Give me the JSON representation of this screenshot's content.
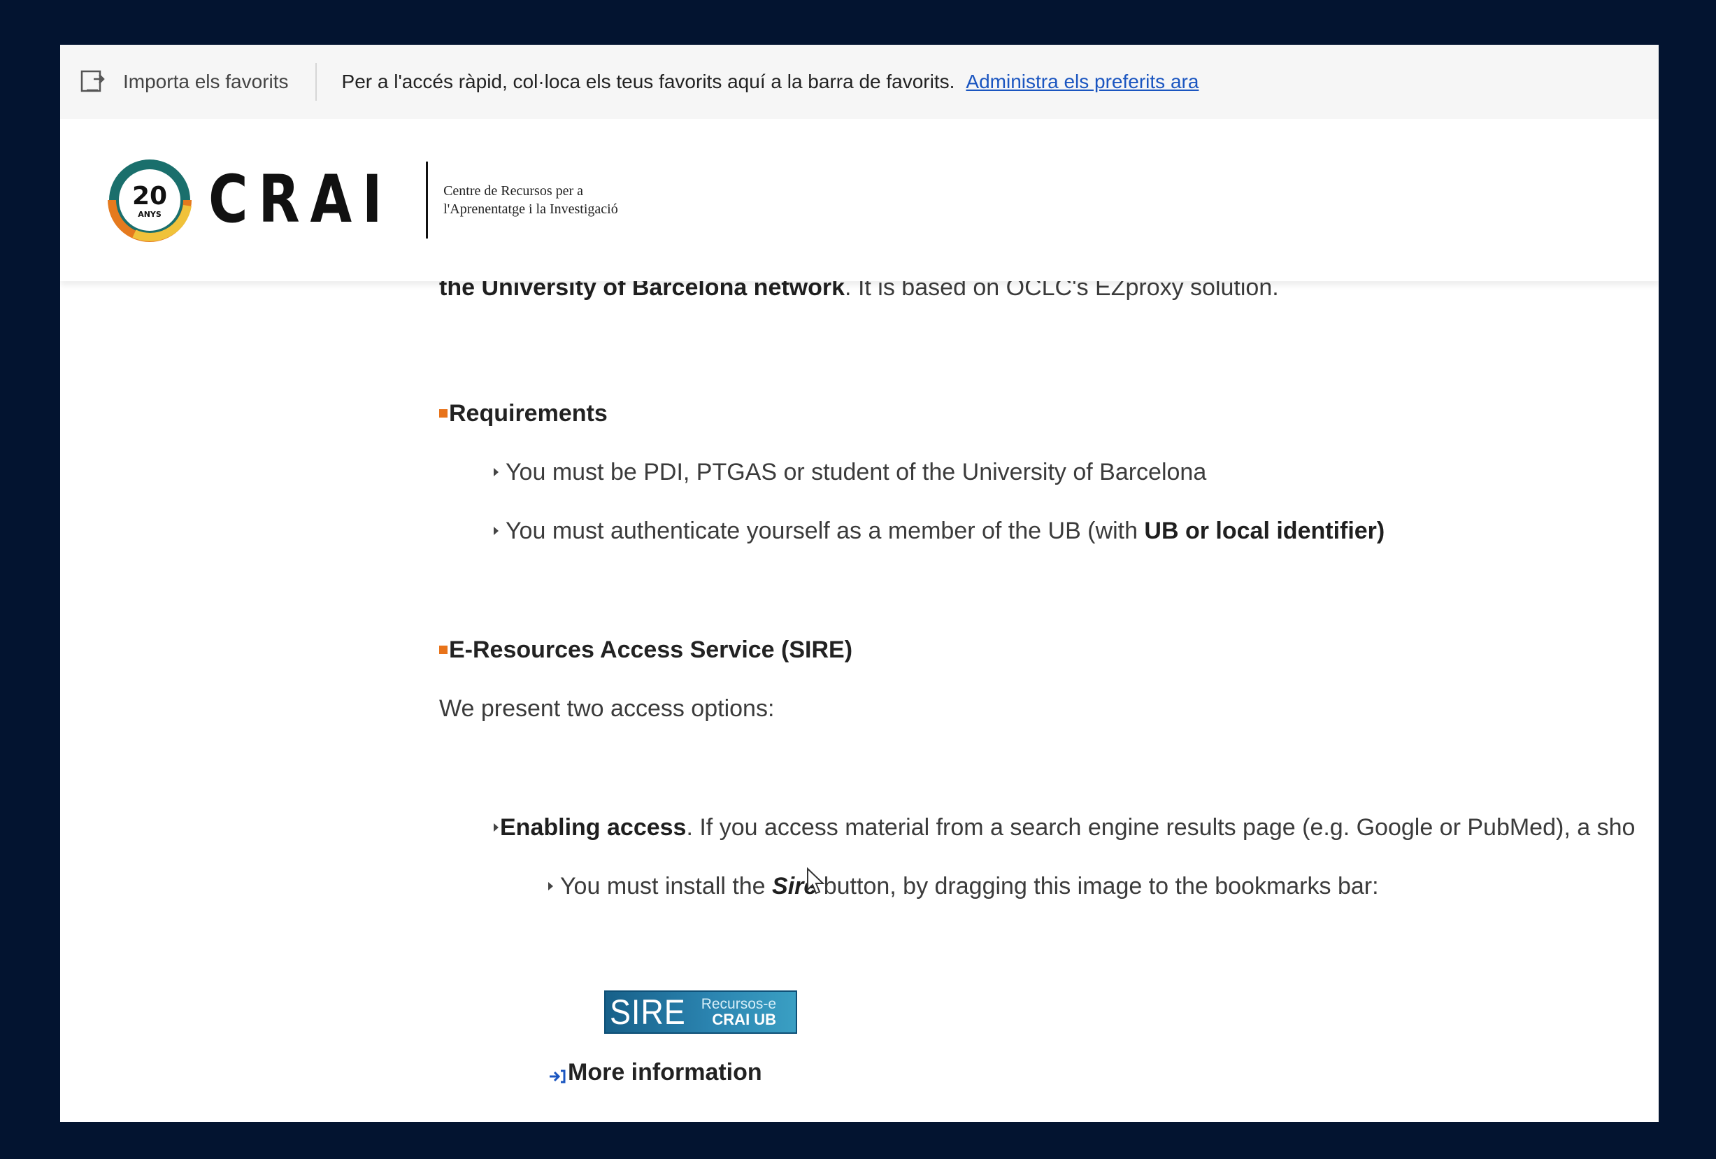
{
  "favorites_bar": {
    "import_label": "Importa els favorits",
    "message": "Per a l'accés ràpid, col·loca els teus favorits aquí a la barra de favorits.",
    "manage_link": "Administra els preferits ara"
  },
  "header": {
    "logo_badge_number": "20",
    "logo_badge_text": "ANYS",
    "logo_word": "CRAI",
    "logo_sub_line1": "Centre de Recursos per a",
    "logo_sub_line2": "l'Aprenentatge i la Investigació",
    "colors": {
      "teal": "#1a6f6c",
      "orange": "#e57a1e",
      "yellow": "#f0c23a"
    }
  },
  "content": {
    "intro_bold": "the University of Barcelona network",
    "intro_rest": ". It is based on OCLC's EZproxy solution.",
    "requirements_heading": "Requirements",
    "req1": "You must be PDI, PTGAS or student of the University of Barcelona",
    "req2_pre": "You must authenticate yourself as a member of the UB (with ",
    "req2_bold": "UB or local identifier)",
    "sire_heading": "E-Resources Access Service (SIRE)",
    "options_intro": "We present two access options:",
    "enabling_bold": "Enabling access",
    "enabling_rest": ". If you access material from a search engine results page (e.g. Google or PubMed), a sho",
    "install_pre": "You must install the ",
    "install_italic": "Sire",
    "install_post": " button, by dragging this image to the bookmarks bar:",
    "sire_button_big": "SIRE",
    "sire_button_small1": "Recursos-e",
    "sire_button_small2": "CRAI UB",
    "more_info": "More information"
  }
}
